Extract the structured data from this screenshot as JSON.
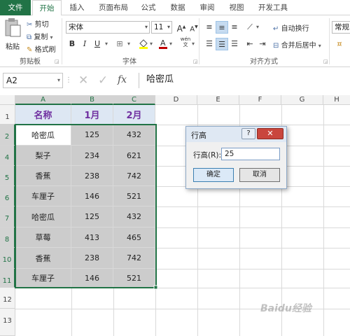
{
  "tabs": [
    "文件",
    "开始",
    "插入",
    "页面布局",
    "公式",
    "数据",
    "审阅",
    "视图",
    "开发工具"
  ],
  "clipboard": {
    "paste": "粘贴",
    "cut": "剪切",
    "copy": "复制",
    "format_painter": "格式刷",
    "group": "剪贴板"
  },
  "font": {
    "name": "宋体",
    "size": "11",
    "grow": "A",
    "shrink": "A",
    "bold": "B",
    "italic": "I",
    "underline": "U",
    "group": "字体",
    "phonetic": "wén"
  },
  "align": {
    "wrap": "自动换行",
    "merge": "合并后居中",
    "group": "对齐方式"
  },
  "number": {
    "format": "常规"
  },
  "formula_bar": {
    "name_box": "A2",
    "content": "哈密瓜",
    "fx": "fx"
  },
  "columns": [
    "A",
    "B",
    "C",
    "D",
    "E",
    "F",
    "G",
    "H"
  ],
  "rows": [
    "1",
    "2",
    "4",
    "5",
    "6",
    "7",
    "8",
    "10",
    "11",
    "12",
    "13"
  ],
  "table": {
    "headers": [
      "名称",
      "1月",
      "2月"
    ],
    "rows": [
      [
        "哈密瓜",
        "125",
        "432"
      ],
      [
        "梨子",
        "234",
        "621"
      ],
      [
        "香蕉",
        "238",
        "742"
      ],
      [
        "车厘子",
        "146",
        "521"
      ],
      [
        "哈密瓜",
        "125",
        "432"
      ],
      [
        "草莓",
        "413",
        "465"
      ],
      [
        "香蕉",
        "238",
        "742"
      ],
      [
        "车厘子",
        "146",
        "521"
      ]
    ]
  },
  "dialog": {
    "title": "行高",
    "help": "?",
    "label": "行高(R):",
    "value": "25",
    "ok": "确定",
    "cancel": "取消"
  },
  "watermark": "Baidu经验",
  "colors": {
    "excel_green": "#217346",
    "header_text": "#7030a0",
    "selection_fill": "#cccccc",
    "header_fill": "#dde7f3"
  }
}
